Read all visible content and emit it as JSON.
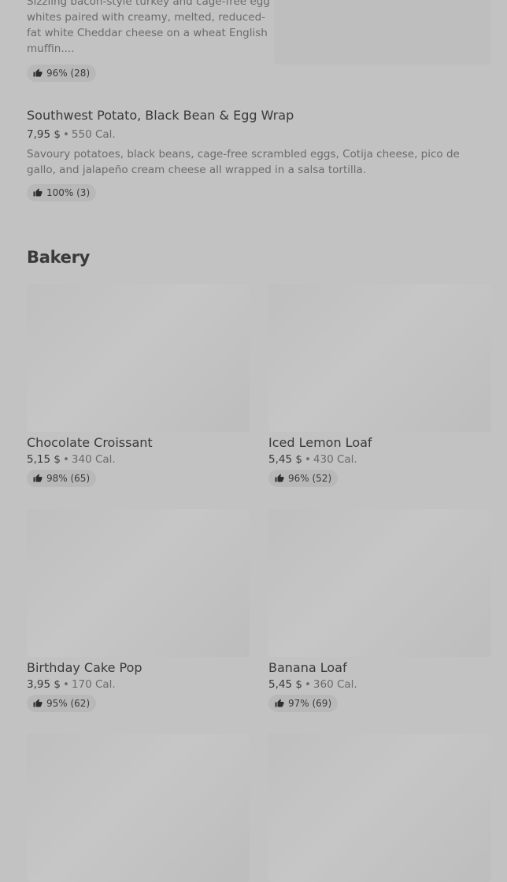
{
  "top_item": {
    "description": "Sizzling bacon-style turkey and cage-free egg whites paired with creamy, melted, reduced-fat white Cheddar cheese on a wheat English muffin....",
    "rating": "96% (28)"
  },
  "wrap_item": {
    "name": "Southwest Potato, Black Bean & Egg Wrap",
    "price": "7,95 $",
    "separator": "•",
    "calories": "550 Cal.",
    "description": "Savoury potatoes, black beans, cage-free scrambled eggs, Cotija cheese, pico de gallo, and jalapeño cream cheese all wrapped in a salsa tortilla.",
    "rating": "100% (3)"
  },
  "bakery": {
    "title": "Bakery",
    "items": [
      {
        "name": "Chocolate Croissant",
        "price": "5,15 $",
        "separator": "•",
        "calories": "340 Cal.",
        "rating": "98% (65)"
      },
      {
        "name": "Iced Lemon Loaf",
        "price": "5,45 $",
        "separator": "•",
        "calories": "430 Cal.",
        "rating": "96% (52)"
      },
      {
        "name": "Birthday Cake Pop",
        "price": "3,95 $",
        "separator": "•",
        "calories": "170 Cal.",
        "rating": "95% (62)"
      },
      {
        "name": "Banana Loaf",
        "price": "5,45 $",
        "separator": "•",
        "calories": "360 Cal.",
        "rating": "97% (69)"
      }
    ]
  },
  "icons": {
    "rating": "thumbs-up-icon"
  },
  "colors": {
    "overlay_background": "#c2c2c2",
    "pill_background": "#b8b8b8",
    "muted_text": "#6b6b6b"
  }
}
